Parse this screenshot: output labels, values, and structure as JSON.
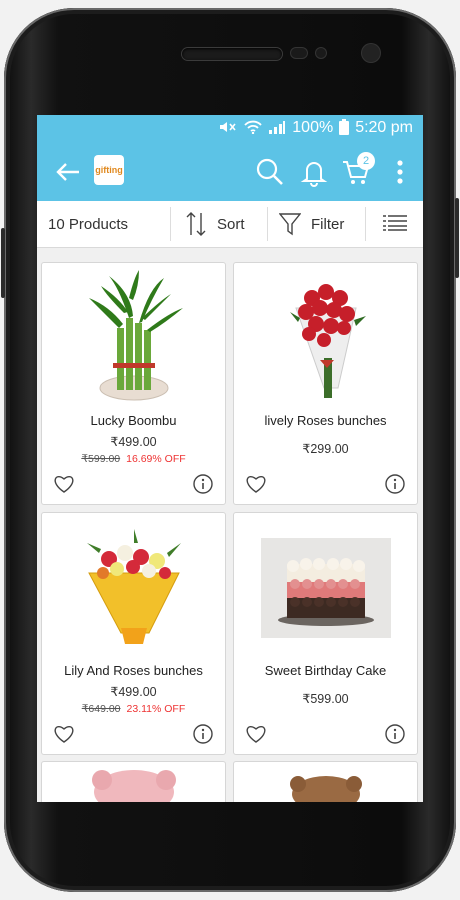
{
  "status_bar": {
    "battery": "100%",
    "time": "5:20 pm"
  },
  "app_bar": {
    "logo_text": "gifting",
    "cart_count": "2"
  },
  "toolbar": {
    "product_count": "10 Products",
    "sort_label": "Sort",
    "filter_label": "Filter"
  },
  "products": [
    {
      "name": "Lucky Boombu",
      "price": "₹499.00",
      "old_price": "₹599.00",
      "discount": "16.69% OFF"
    },
    {
      "name": "lively Roses bunches",
      "price": "₹299.00"
    },
    {
      "name": "Lily And Roses bunches",
      "price": "₹499.00",
      "old_price": "₹649.00",
      "discount": "23.11% OFF"
    },
    {
      "name": "Sweet Birthday Cake",
      "price": "₹599.00"
    }
  ],
  "colors": {
    "app_bar": "#5cc3e6",
    "discount": "#e33333"
  }
}
